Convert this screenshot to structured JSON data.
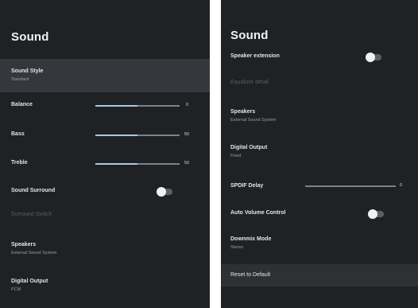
{
  "left": {
    "title": "Sound",
    "sound_style": {
      "label": "Sound Style",
      "value": "Standard"
    },
    "balance": {
      "label": "Balance",
      "value": "0",
      "level": 0.5
    },
    "bass": {
      "label": "Bass",
      "value": "50",
      "level": 0.5
    },
    "treble": {
      "label": "Treble",
      "value": "50",
      "level": 0.5
    },
    "sound_surround": {
      "label": "Sound Surround",
      "on": false
    },
    "surround_disabled": {
      "label": "Surround Switch"
    },
    "speakers": {
      "label": "Speakers",
      "value": "External Sound System"
    },
    "digital_output": {
      "label": "Digital Output",
      "value": "PCM"
    }
  },
  "right": {
    "title": "Sound",
    "partial_item": {
      "label": "Speaker extension",
      "on": false
    },
    "disabled_item": {
      "label": "Equalizer detail"
    },
    "speakers": {
      "label": "Speakers",
      "value": "External Sound System"
    },
    "digital_output": {
      "label": "Digital Output",
      "value": "Fixed"
    },
    "spdif_delay": {
      "label": "SPDIF Delay",
      "value": "0",
      "level": 0
    },
    "auto_volume": {
      "label": "Auto Volume Control",
      "on": false
    },
    "downmix": {
      "label": "Downmix Mode",
      "value": "Stereo"
    },
    "reset": {
      "label": "Reset to Default"
    }
  }
}
